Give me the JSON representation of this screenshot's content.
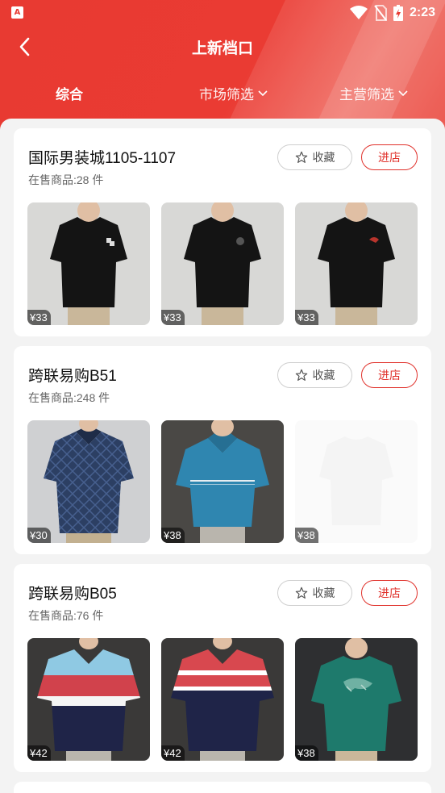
{
  "statusbar": {
    "time": "2:23",
    "app_badge": "A"
  },
  "header": {
    "title": "上新档口"
  },
  "tabs": [
    {
      "label": "综合",
      "active": true
    },
    {
      "label": "市场筛选",
      "dropdown": true
    },
    {
      "label": "主营筛选",
      "dropdown": true
    }
  ],
  "colors": {
    "brand_red": "#e83a32",
    "enter_red": "#e0312b"
  },
  "shops": [
    {
      "name": "国际男装城1105-1107",
      "count": "在售商品:28 件",
      "fav_label": "收藏",
      "enter_label": "进店",
      "products": [
        {
          "price": "¥33",
          "image": "black-tshirt-logo"
        },
        {
          "price": "¥33",
          "image": "black-tshirt-badge"
        },
        {
          "price": "¥33",
          "image": "black-tshirt-emblem"
        }
      ]
    },
    {
      "name": "跨联易购B51",
      "count": "在售商品:248 件",
      "fav_label": "收藏",
      "enter_label": "进店",
      "products": [
        {
          "price": "¥30",
          "image": "navy-pattern-polo"
        },
        {
          "price": "¥38",
          "image": "blue-polo"
        },
        {
          "price": "¥38",
          "image": "white-blank"
        }
      ]
    },
    {
      "name": "跨联易购B05",
      "count": "在售商品:76 件",
      "fav_label": "收藏",
      "enter_label": "进店",
      "products": [
        {
          "price": "¥42",
          "image": "striped-polo-lightblue"
        },
        {
          "price": "¥42",
          "image": "striped-polo-red"
        },
        {
          "price": "¥38",
          "image": "green-printed-tshirt"
        }
      ]
    }
  ]
}
